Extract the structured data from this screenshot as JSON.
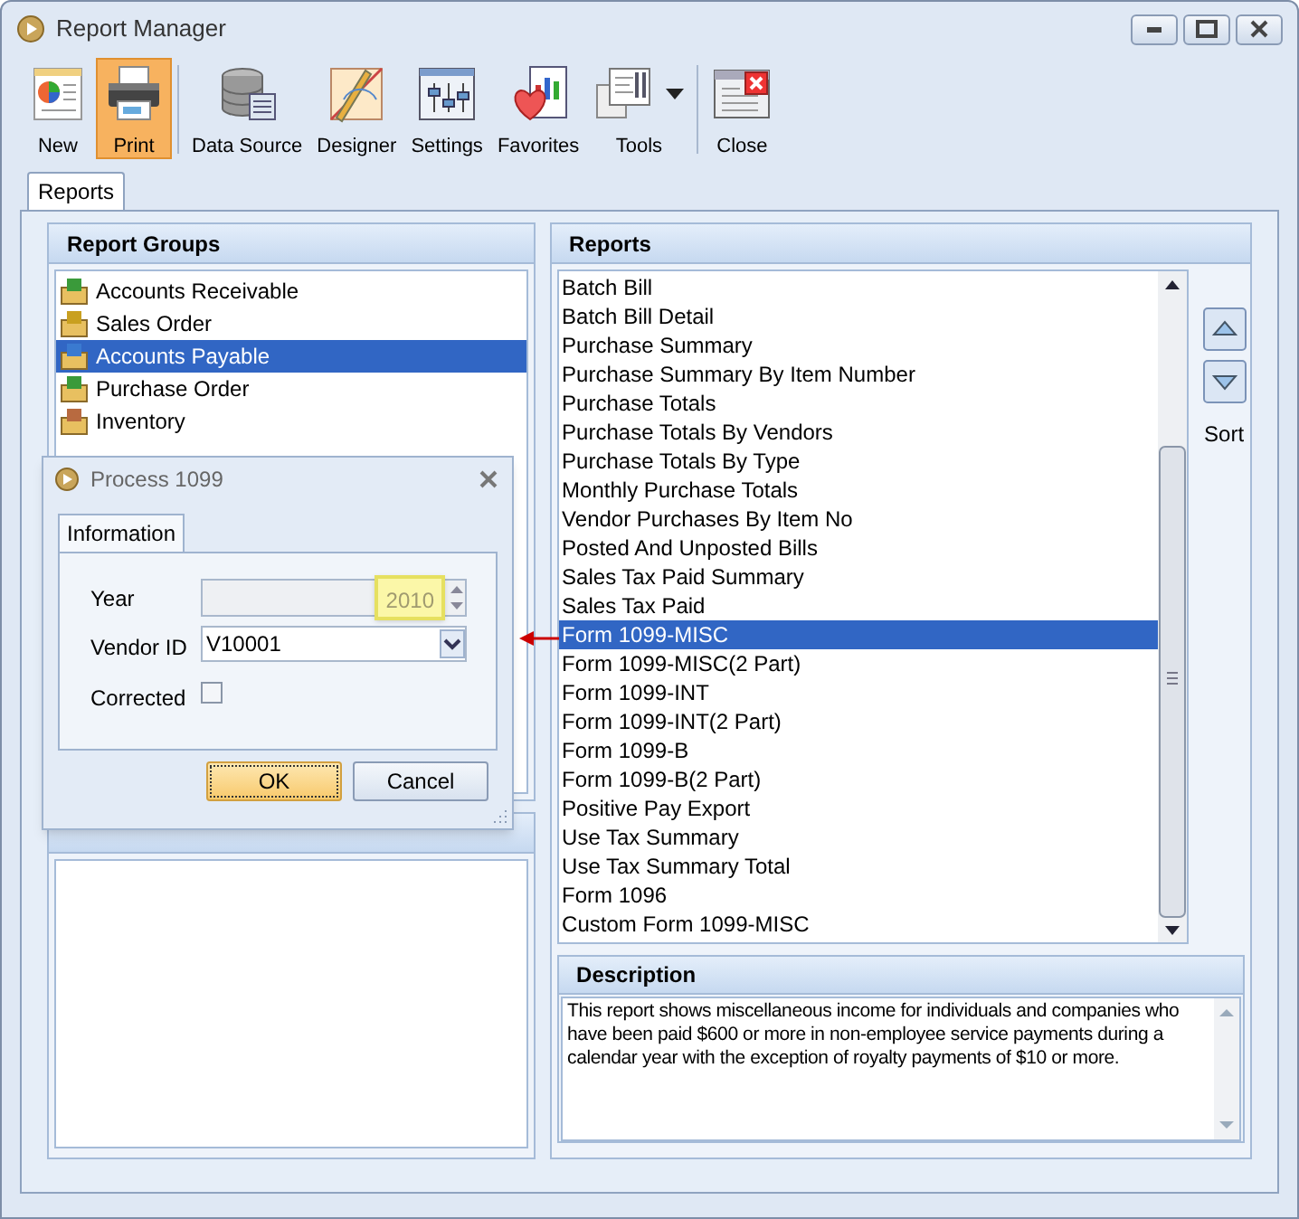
{
  "window": {
    "title": "Report Manager"
  },
  "toolbar_groups": [
    [
      {
        "label": "New",
        "selected": false,
        "kind": "button"
      },
      {
        "label": "Print",
        "selected": true,
        "kind": "button"
      }
    ],
    [
      {
        "label": "Data Source",
        "selected": false,
        "kind": "button"
      },
      {
        "label": "Designer",
        "selected": false,
        "kind": "button"
      },
      {
        "label": "Settings",
        "selected": false,
        "kind": "button"
      },
      {
        "label": "Favorites",
        "selected": false,
        "kind": "button"
      },
      {
        "label": "Tools",
        "selected": false,
        "kind": "dropdown"
      }
    ],
    [
      {
        "label": "Close",
        "selected": false,
        "kind": "button"
      }
    ]
  ],
  "tabs": [
    {
      "label": "Reports",
      "selected": true
    }
  ],
  "report_groups": {
    "title": "Report Groups",
    "items": [
      {
        "label": "Accounts Receivable",
        "selected": false
      },
      {
        "label": "Sales Order",
        "selected": false
      },
      {
        "label": "Accounts Payable",
        "selected": true
      },
      {
        "label": "Purchase Order",
        "selected": false
      },
      {
        "label": "Inventory",
        "selected": false
      }
    ]
  },
  "reports": {
    "title": "Reports",
    "sort_label": "Sort",
    "items": [
      {
        "label": "Batch Bill",
        "selected": false
      },
      {
        "label": "Batch Bill Detail",
        "selected": false
      },
      {
        "label": "Purchase Summary",
        "selected": false
      },
      {
        "label": "Purchase Summary By Item Number",
        "selected": false
      },
      {
        "label": "Purchase Totals",
        "selected": false
      },
      {
        "label": "Purchase Totals By Vendors",
        "selected": false
      },
      {
        "label": "Purchase Totals By Type",
        "selected": false
      },
      {
        "label": "Monthly Purchase Totals",
        "selected": false
      },
      {
        "label": "Vendor Purchases By Item No",
        "selected": false
      },
      {
        "label": "Posted And Unposted Bills",
        "selected": false
      },
      {
        "label": "Sales Tax Paid Summary",
        "selected": false
      },
      {
        "label": "Sales Tax Paid",
        "selected": false
      },
      {
        "label": "Form 1099-MISC",
        "selected": true
      },
      {
        "label": "Form 1099-MISC(2 Part)",
        "selected": false
      },
      {
        "label": "Form 1099-INT",
        "selected": false
      },
      {
        "label": "Form 1099-INT(2 Part)",
        "selected": false
      },
      {
        "label": "Form 1099-B",
        "selected": false
      },
      {
        "label": "Form 1099-B(2 Part)",
        "selected": false
      },
      {
        "label": "Positive Pay Export",
        "selected": false
      },
      {
        "label": "Use Tax Summary",
        "selected": false
      },
      {
        "label": "Use Tax Summary Total",
        "selected": false
      },
      {
        "label": "Form 1096",
        "selected": false
      },
      {
        "label": "Custom Form 1099-MISC",
        "selected": false
      }
    ]
  },
  "description": {
    "title": "Description",
    "text": "This report shows miscellaneous income for individuals and companies who have been paid $600 or more in non-employee service payments during a calendar year with the exception of royalty payments of $10 or more."
  },
  "dialog": {
    "title": "Process 1099",
    "tabs": [
      {
        "label": "Information",
        "selected": true
      }
    ],
    "year": {
      "label": "Year",
      "value": "2010",
      "disabled": true,
      "highlighted": true
    },
    "vendor_id": {
      "label": "Vendor ID",
      "value": "V10001"
    },
    "corrected": {
      "label": "Corrected",
      "checked": false
    },
    "buttons": [
      {
        "label": "OK",
        "default": true
      },
      {
        "label": "Cancel",
        "default": false
      }
    ]
  }
}
